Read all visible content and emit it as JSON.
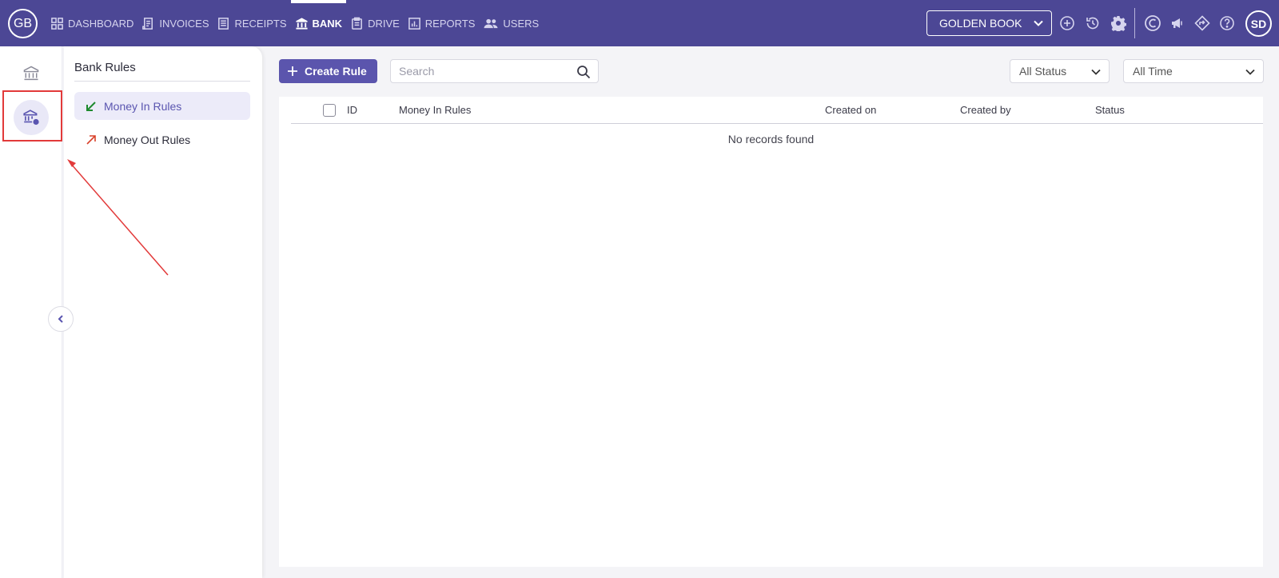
{
  "app": {
    "logo_text": "GB",
    "avatar_initials": "SD"
  },
  "nav": {
    "items": [
      {
        "label": "DASHBOARD",
        "icon": "grid-icon"
      },
      {
        "label": "INVOICES",
        "icon": "invoice-icon"
      },
      {
        "label": "RECEIPTS",
        "icon": "receipt-icon"
      },
      {
        "label": "BANK",
        "icon": "bank-icon",
        "active": true
      },
      {
        "label": "DRIVE",
        "icon": "clipboard-icon"
      },
      {
        "label": "REPORTS",
        "icon": "bar-chart-icon"
      },
      {
        "label": "USERS",
        "icon": "users-icon"
      }
    ]
  },
  "company_selector": {
    "value": "GOLDEN BOOK"
  },
  "subnav": {
    "title": "Bank Rules",
    "items": [
      {
        "label": "Money In Rules",
        "active": true
      },
      {
        "label": "Money Out Rules"
      }
    ]
  },
  "toolbar": {
    "create_label": "Create Rule",
    "search_placeholder": "Search",
    "status_filter": "All Status",
    "time_filter": "All Time"
  },
  "table": {
    "columns": [
      "ID",
      "Money In Rules",
      "Created on",
      "Created by",
      "Status"
    ],
    "empty_text": "No records found"
  },
  "colors": {
    "topbar": "#4c4795",
    "accent": "#5b55ad",
    "money_in": "#1e8a2e",
    "money_out": "#d9422b",
    "annotation": "#e23a3a"
  }
}
